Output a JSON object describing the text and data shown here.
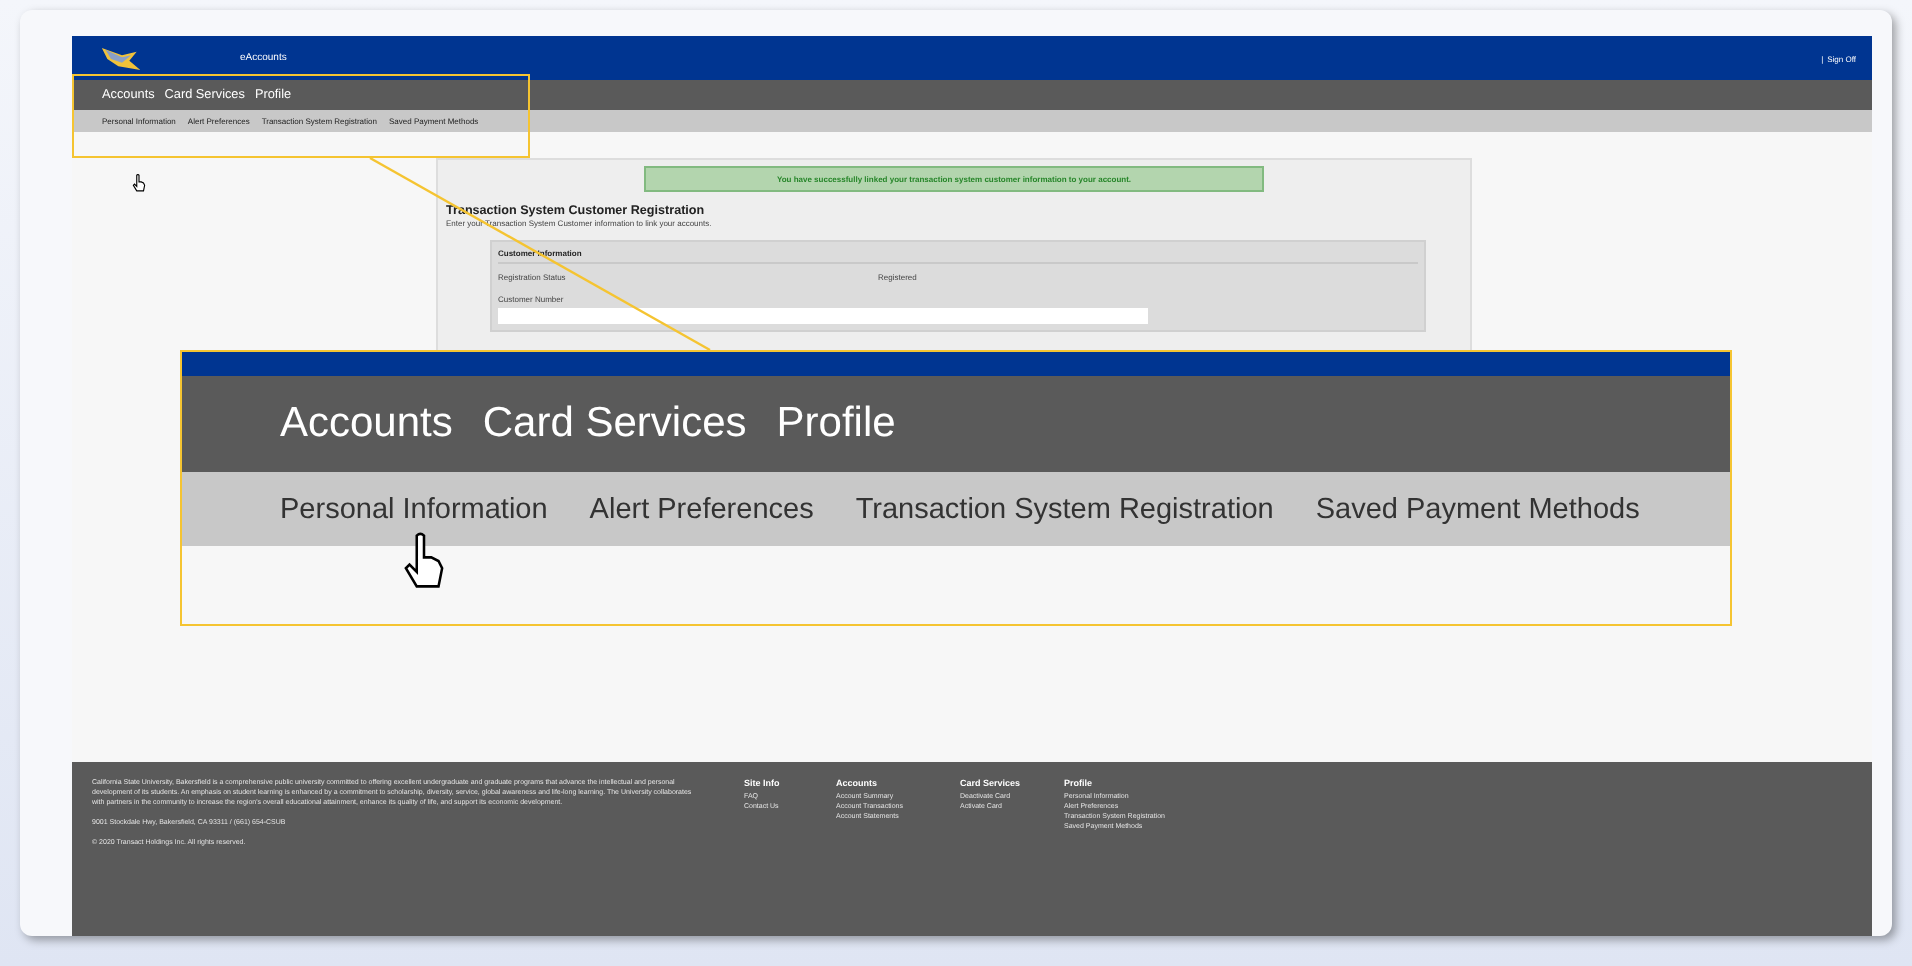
{
  "header": {
    "app_name": "eAccounts",
    "separator": "|",
    "sign_off": "Sign Off"
  },
  "nav": [
    {
      "label": "Accounts"
    },
    {
      "label": "Card Services"
    },
    {
      "label": "Profile"
    }
  ],
  "subnav": [
    {
      "label": "Personal Information"
    },
    {
      "label": "Alert Preferences"
    },
    {
      "label": "Transaction System Registration"
    },
    {
      "label": "Saved Payment Methods"
    }
  ],
  "alert": {
    "message": "You have successfully linked your transaction system customer information to your account."
  },
  "form": {
    "title": "Transaction System Customer Registration",
    "subtitle": "Enter your Transaction System Customer information to link your accounts.",
    "section_title": "Customer Information",
    "status_label": "Registration Status",
    "status_value": "Registered",
    "number_label": "Customer Number"
  },
  "callout": {
    "nav": [
      {
        "label": "Accounts"
      },
      {
        "label": "Card Services"
      },
      {
        "label": "Profile"
      }
    ],
    "subnav": [
      {
        "label": "Personal Information"
      },
      {
        "label": "Alert Preferences"
      },
      {
        "label": "Transaction System Registration"
      },
      {
        "label": "Saved Payment Methods"
      }
    ]
  },
  "footer": {
    "about": "California State University, Bakersfield is a comprehensive public university committed to offering excellent undergraduate and graduate programs that advance the intellectual and personal development of its students. An emphasis on student learning is enhanced by a commitment to scholarship, diversity, service, global awareness and life-long learning. The University collaborates with partners in the community to increase the region's overall educational attainment, enhance its quality of life, and support its economic development.",
    "address": "9001 Stockdale Hwy, Bakersfield, CA 93311 / (661) 654-CSUB",
    "copyright": "© 2020 Transact Holdings Inc. All rights reserved.",
    "columns": [
      {
        "heading": "Site Info",
        "links": [
          "FAQ",
          "Contact Us"
        ]
      },
      {
        "heading": "Accounts",
        "links": [
          "Account Summary",
          "Account Transactions",
          "Account Statements"
        ]
      },
      {
        "heading": "Card Services",
        "links": [
          "Deactivate Card",
          "Activate Card"
        ]
      },
      {
        "heading": "Profile",
        "links": [
          "Personal Information",
          "Alert Preferences",
          "Transaction System Registration",
          "Saved Payment Methods"
        ]
      }
    ]
  }
}
